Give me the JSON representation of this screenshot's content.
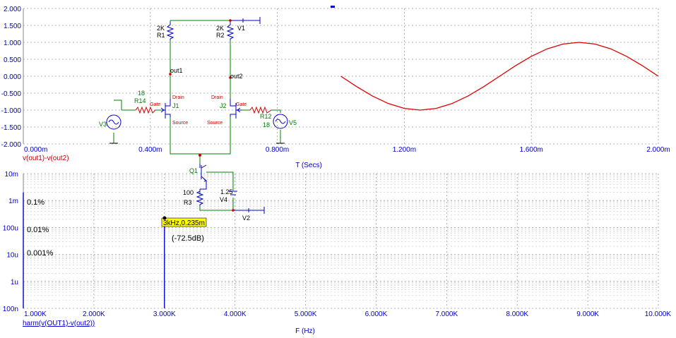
{
  "colors": {
    "background": "#ffffff",
    "grid": "#9a9a9a",
    "axis_text": "#0000cc",
    "trace": "#e00000",
    "harmonic": "#0000cc",
    "schematic_wire": "#008000",
    "component": "#0000cc",
    "node_label": "#cc0000",
    "tooltip": "#ffff00"
  },
  "chart_data": [
    {
      "type": "line",
      "id": "transient",
      "title": "",
      "trace_label": "v(out1)-v(out2)",
      "xlabel": "T (Secs)",
      "ylabel": "",
      "xlim": [
        0,
        2.0
      ],
      "ylim": [
        -2.0,
        2.0
      ],
      "x_tick_values": [
        0,
        0.4,
        0.8,
        1.2,
        1.6,
        2.0
      ],
      "x_tick_labels": [
        "0.000m",
        "0.400m",
        "0.800m",
        "1.200m",
        "1.600m",
        "2.000m"
      ],
      "y_tick_values": [
        2.0,
        1.5,
        1.0,
        0.5,
        0.0,
        -0.5,
        -1.0,
        -1.5,
        -2.0
      ],
      "y_tick_labels": [
        "2.000",
        "1.500",
        "1.000",
        "0.500",
        "0.000",
        "-0.500",
        "-1.000",
        "-1.500",
        "-2.000"
      ],
      "series": [
        {
          "x": [
            1.0,
            1.05,
            1.1,
            1.15,
            1.2,
            1.25,
            1.3,
            1.35,
            1.4,
            1.45,
            1.5,
            1.55,
            1.6,
            1.65,
            1.7,
            1.75,
            1.8,
            1.85,
            1.9,
            1.95,
            2.0
          ],
          "y": [
            0.0,
            -0.309,
            -0.588,
            -0.809,
            -0.951,
            -1.0,
            -0.951,
            -0.809,
            -0.588,
            -0.309,
            0.0,
            0.309,
            0.588,
            0.809,
            0.951,
            1.0,
            0.951,
            0.809,
            0.588,
            0.309,
            0.0
          ]
        }
      ],
      "grid": true
    },
    {
      "type": "bar",
      "id": "harmonics",
      "title": "",
      "trace_label": "harm(v(OUT1)-v(out2))",
      "xlabel": "F (Hz)",
      "ylabel": "",
      "xlim": [
        1000,
        10000
      ],
      "ylim_log": [
        1e-07,
        0.01
      ],
      "x_tick_values": [
        1000,
        2000,
        3000,
        4000,
        5000,
        6000,
        7000,
        8000,
        9000,
        10000
      ],
      "x_tick_labels": [
        "1.000K",
        "2.000K",
        "3.000K",
        "4.000K",
        "5.000K",
        "6.000K",
        "7.000K",
        "8.000K",
        "9.000K",
        "10.000K"
      ],
      "y_tick_values": [
        0.01,
        0.001,
        0.0001,
        1e-05,
        1e-06,
        1e-07
      ],
      "y_tick_labels": [
        "10m",
        "1m",
        "100u",
        "10u",
        "1u",
        "100n"
      ],
      "series": [
        {
          "x": [
            1000,
            3000
          ],
          "y": [
            0.002,
            0.000235
          ]
        }
      ],
      "annotations": {
        "marker": "3kHz,0.235m",
        "db": "(-72.5dB)",
        "levels": [
          {
            "text": "0.1%",
            "y": 0.001
          },
          {
            "text": "0.01%",
            "y": 0.0001
          },
          {
            "text": "0.001%",
            "y": 1e-05
          }
        ]
      },
      "grid": true
    }
  ],
  "schematic": {
    "r1": {
      "value": "2K",
      "name": "R1"
    },
    "r2": {
      "value": "2K",
      "name": "R2"
    },
    "v1": "V1",
    "out1": "out1",
    "out2": "out2",
    "r14": {
      "value": "18",
      "name": "R14"
    },
    "r12": {
      "value": "R12",
      "name": "18"
    },
    "v3": "V3",
    "v5": "V5",
    "j1": {
      "name": "J1",
      "gate": "Gate",
      "drain": "Drain",
      "source": "Source"
    },
    "j2": {
      "name": "J2",
      "gate": "Gate",
      "drain": "Drain",
      "source": "Source"
    },
    "q1": "Q1",
    "r3": {
      "value": "100",
      "name": "R3"
    },
    "v4": {
      "value": "1.25",
      "name": "V4"
    },
    "v2": "V2"
  }
}
